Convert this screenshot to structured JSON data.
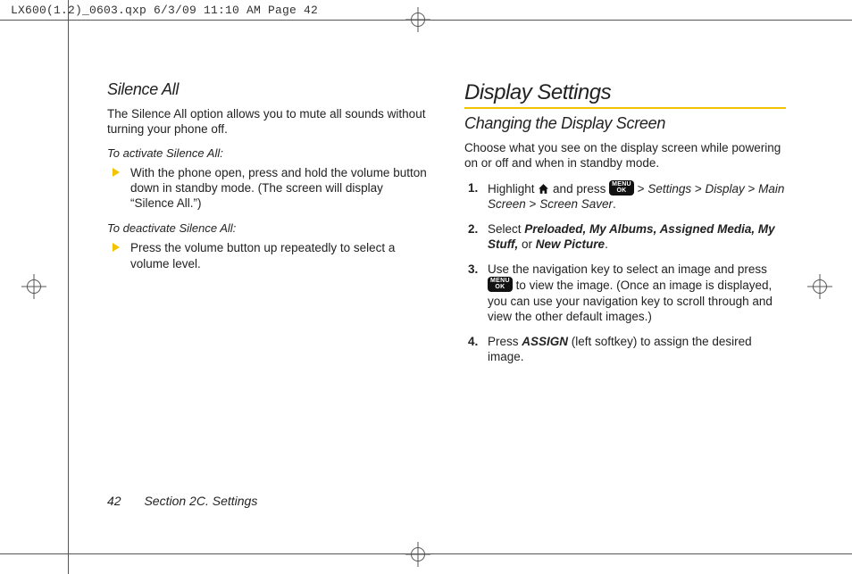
{
  "crop_header": "LX600(1.2)_0603.qxp  6/3/09  11:10 AM  Page 42",
  "left": {
    "h3": "Silence All",
    "intro": "The Silence All option allows you to mute all sounds without turning your phone off.",
    "lead1": "To activate Silence All:",
    "b1": "With the phone open, press and hold the volume button down in standby mode. (The screen will display “Silence All.”)",
    "lead2": "To deactivate Silence All:",
    "b2": "Press the volume button up repeatedly to select a volume level."
  },
  "right": {
    "h2": "Display Settings",
    "h3": "Changing the Display Screen",
    "intro": "Choose what you see on the display screen while powering on or off and when in standby mode.",
    "s1a": "Highlight ",
    "s1b": " and press ",
    "path1": "Settings",
    "path2": "Display",
    "path3": "Main Screen",
    "path4": "Screen Saver",
    "gt": ">",
    "s2a": "Select ",
    "s2opts": "Preloaded, My Albums, Assigned Media, My Stuff,",
    "s2or": " or ",
    "s2last": "New Picture",
    "s3a": "Use the navigation key to select an image and press ",
    "s3b": " to view the image. (Once an image is displayed, you can use your navigation key to scroll through and view the other default images.)",
    "s4a": "Press ",
    "s4key": "ASSIGN",
    "s4b": " (left softkey)  to assign the desired image."
  },
  "footer": {
    "page": "42",
    "section": "Section 2C. Settings"
  },
  "key_label_top": "MENU",
  "key_label_bot": "OK"
}
